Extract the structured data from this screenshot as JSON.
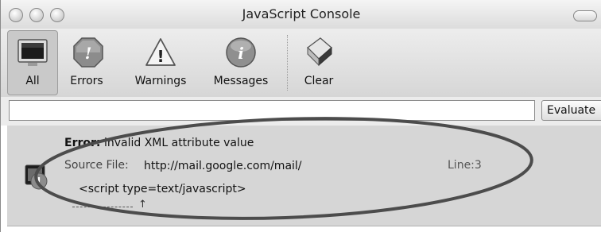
{
  "window": {
    "title": "JavaScript Console"
  },
  "toolbar": {
    "items": [
      {
        "label": "All",
        "icon": "monitor-icon",
        "selected": true
      },
      {
        "label": "Errors",
        "icon": "error-stop-icon"
      },
      {
        "label": "Warnings",
        "icon": "warning-triangle-icon"
      },
      {
        "label": "Messages",
        "icon": "info-icon"
      },
      {
        "label": "Clear",
        "icon": "eraser-icon"
      }
    ]
  },
  "evaluate": {
    "input_value": "",
    "button_label": "Evaluate"
  },
  "message": {
    "title_prefix": "Error:",
    "title_text": " invalid XML attribute value",
    "source_label": "Source File:",
    "source_url": "http://mail.google.com/mail/",
    "line": "Line:3",
    "code": "<script type=text/javascript>",
    "caret": "↑"
  },
  "colors": {
    "annotation_ellipse": "#555555",
    "error_icon": "#8c8c8c"
  }
}
